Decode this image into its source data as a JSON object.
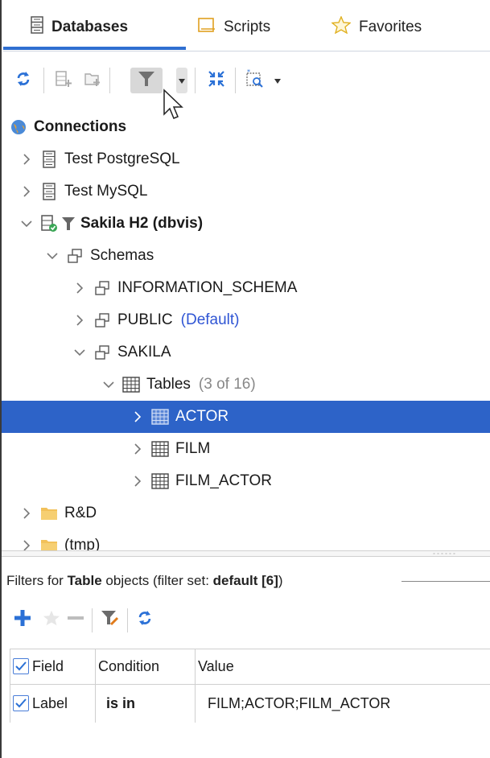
{
  "tabs": [
    {
      "label": "Databases",
      "icon": "database-list-icon",
      "active": true
    },
    {
      "label": "Scripts",
      "icon": "script-icon",
      "active": false
    },
    {
      "label": "Favorites",
      "icon": "star-icon",
      "active": false
    }
  ],
  "toolbar": {
    "buttons": [
      "refresh-icon",
      "add-connection-icon",
      "add-folder-icon",
      "filter-icon",
      "collapse-all-icon",
      "new-connection-wizard-icon"
    ]
  },
  "tree": {
    "items": [
      {
        "label": "Connections",
        "note": "",
        "icon": "connections-globe-icon",
        "expanded": true
      },
      {
        "label": "Test PostgreSQL",
        "note": "",
        "icon": "database-icon",
        "expanded": false
      },
      {
        "label": "Test MySQL",
        "note": "",
        "icon": "database-icon",
        "expanded": false
      },
      {
        "label": "Sakila H2 (dbvis)",
        "note": "",
        "icon": "connected-database-icon",
        "expanded": true
      },
      {
        "label": "Schemas",
        "note": "",
        "icon": "schema-icon",
        "expanded": true
      },
      {
        "label": "INFORMATION_SCHEMA",
        "note": "",
        "icon": "schema-icon",
        "expanded": false
      },
      {
        "label": "PUBLIC",
        "note": "(Default)",
        "icon": "schema-icon",
        "expanded": false
      },
      {
        "label": "SAKILA",
        "note": "",
        "icon": "schema-icon",
        "expanded": true
      },
      {
        "label": "Tables",
        "note": "(3 of 16)",
        "icon": "table-icon",
        "expanded": true
      },
      {
        "label": "ACTOR",
        "note": "",
        "icon": "table-icon",
        "expanded": false
      },
      {
        "label": "FILM",
        "note": "",
        "icon": "table-icon",
        "expanded": false
      },
      {
        "label": "FILM_ACTOR",
        "note": "",
        "icon": "table-icon",
        "expanded": false
      },
      {
        "label": "R&D",
        "note": "",
        "icon": "folder-icon",
        "expanded": false
      },
      {
        "label": "(tmp)",
        "note": "",
        "icon": "folder-icon",
        "expanded": false
      }
    ]
  },
  "filter": {
    "title_prefix": "Filters for ",
    "title_object": "Table",
    "title_middle": " objects (filter set: ",
    "title_set": "default [6]",
    "title_suffix": ")",
    "toolbar": [
      "add-icon",
      "favorite-star-icon",
      "remove-icon",
      "filter-settings-icon",
      "refresh-icon"
    ],
    "columns": [
      "Field",
      "Condition",
      "Value"
    ],
    "rows": [
      {
        "checked": true,
        "field": "Label",
        "condition": "is in",
        "value": "FILM;ACTOR;FILM_ACTOR"
      }
    ]
  },
  "colors": {
    "accent": "#2f6fd1",
    "selection": "#2d63c8",
    "default_note": "#2f55d4",
    "add": "#2a70d6"
  }
}
